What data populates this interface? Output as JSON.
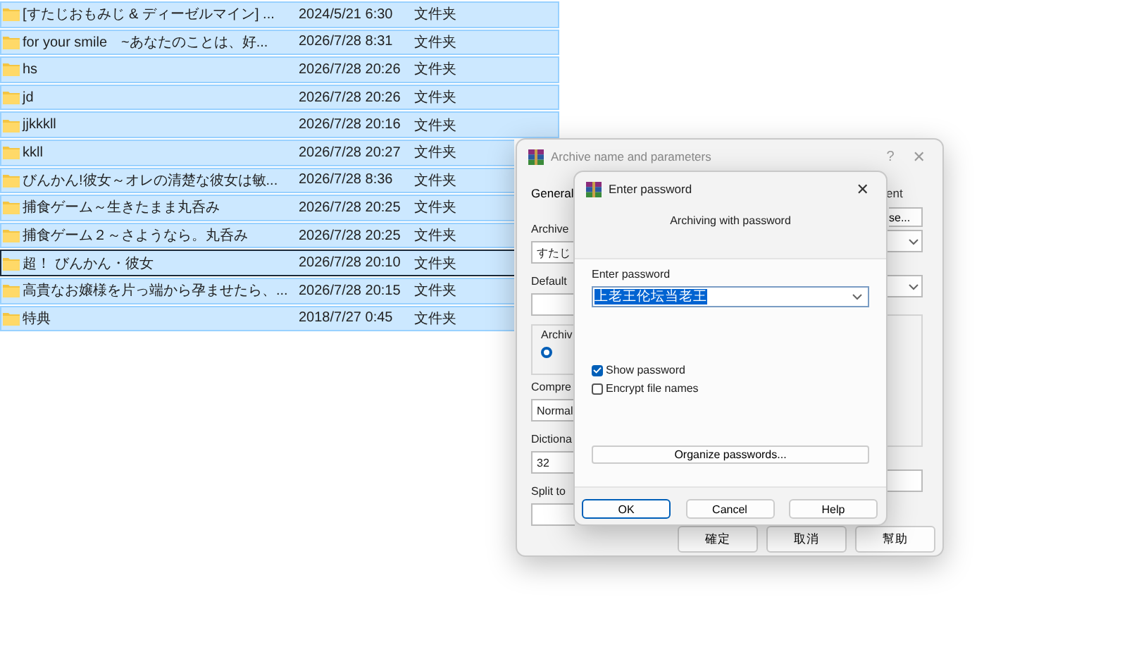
{
  "file_list": {
    "rows": [
      {
        "name": "[すたじおもみじ & ディーゼルマイン] ...",
        "date": "2024/5/21 6:30",
        "type": "文件夹",
        "selected": true,
        "focused": false
      },
      {
        "name": "for your smile　~あなたのことは、好...",
        "date": "2026/7/28 8:31",
        "type": "文件夹",
        "selected": true,
        "focused": false
      },
      {
        "name": "hs",
        "date": "2026/7/28 20:26",
        "type": "文件夹",
        "selected": true,
        "focused": false
      },
      {
        "name": "jd",
        "date": "2026/7/28 20:26",
        "type": "文件夹",
        "selected": true,
        "focused": false
      },
      {
        "name": "jjkkkll",
        "date": "2026/7/28 20:16",
        "type": "文件夹",
        "selected": true,
        "focused": false
      },
      {
        "name": "kkll",
        "date": "2026/7/28 20:27",
        "type": "文件夹",
        "selected": true,
        "focused": false
      },
      {
        "name": "びんかん!彼女～オレの清楚な彼女は敏...",
        "date": "2026/7/28 8:36",
        "type": "文件夹",
        "selected": true,
        "focused": false
      },
      {
        "name": "捕食ゲーム～生きたまま丸呑み",
        "date": "2026/7/28 20:25",
        "type": "文件夹",
        "selected": true,
        "focused": false
      },
      {
        "name": "捕食ゲーム２～さようなら。丸呑み",
        "date": "2026/7/28 20:25",
        "type": "文件夹",
        "selected": true,
        "focused": false
      },
      {
        "name": "超！ びんかん・彼女",
        "date": "2026/7/28 20:10",
        "type": "文件夹",
        "selected": true,
        "focused": true
      },
      {
        "name": "高貴なお嬢様を片っ端から孕ませたら、...",
        "date": "2026/7/28 20:15",
        "type": "文件夹",
        "selected": true,
        "focused": false
      },
      {
        "name": "特典",
        "date": "2018/7/27 0:45",
        "type": "文件夹",
        "selected": true,
        "focused": false
      }
    ]
  },
  "archive_dialog": {
    "title": "Archive name and parameters",
    "help_glyph": "?",
    "close_glyph": "✕",
    "tabs": [
      {
        "label": "General",
        "selected": true
      },
      {
        "label": "ent",
        "selected": false
      }
    ],
    "archive_label": "Archive",
    "archive_value": "すたじ",
    "browse_button": "se...",
    "default_label": "Default",
    "group_label": "Archiv",
    "radio": {
      "selected": true
    },
    "compression_label": "Compre",
    "compression_value": "Normal",
    "dictionary_label": "Dictiona",
    "dictionary_value": "32",
    "split_label": "Split to",
    "buttons": [
      "確定",
      "取消",
      "幫助"
    ]
  },
  "password_dialog": {
    "title": "Enter password",
    "close_glyph": "✕",
    "heading": "Archiving with password",
    "field_label": "Enter password",
    "password": "上老王伦坛当老王",
    "checkboxes": [
      {
        "label": "Show password",
        "checked": true
      },
      {
        "label": "Encrypt file names",
        "checked": false
      }
    ],
    "organize_button": "Organize passwords...",
    "buttons": [
      {
        "label": "OK",
        "default": true
      },
      {
        "label": "Cancel",
        "default": false
      },
      {
        "label": "Help",
        "default": false
      }
    ]
  }
}
